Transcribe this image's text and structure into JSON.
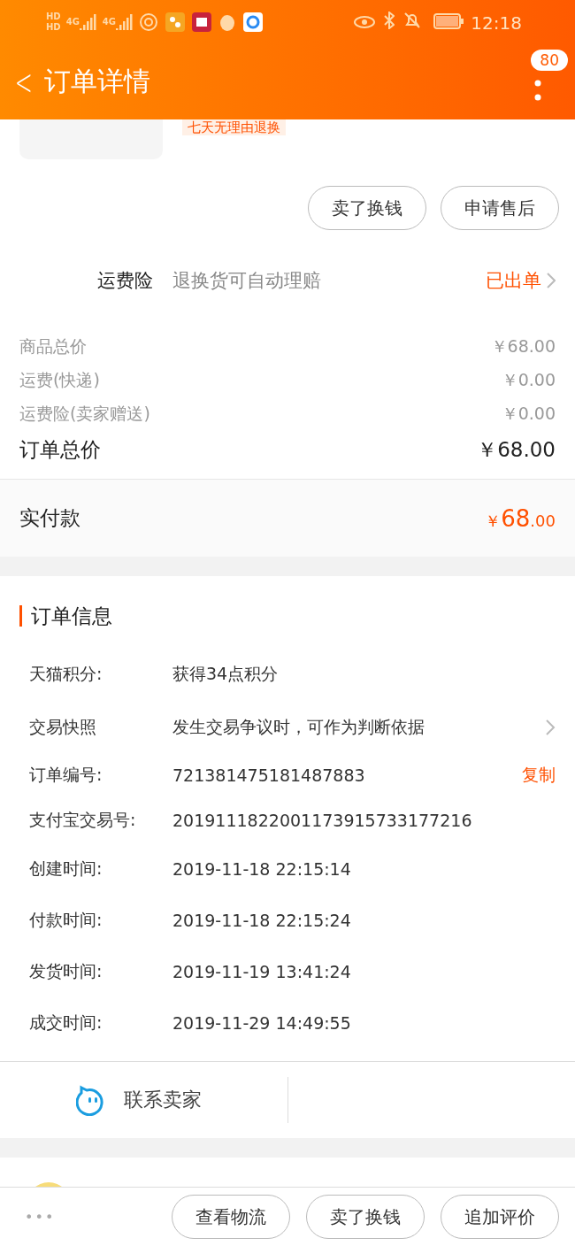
{
  "status_bar": {
    "hd_labels": [
      "HD",
      "HD"
    ],
    "network_labels": [
      "4G",
      "4G"
    ],
    "time": "12:18"
  },
  "header": {
    "back": "<",
    "title": "订单详情",
    "badge": "80"
  },
  "product": {
    "tag": "七天无理由退换"
  },
  "item_actions": [
    "卖了换钱",
    "申请售后"
  ],
  "insurance": {
    "label": "运费险",
    "description": "退换货可自动理赔",
    "status": "已出单"
  },
  "prices": [
    {
      "label": "商品总价",
      "value": "￥68.00"
    },
    {
      "label": "运费(快递)",
      "value": "￥0.00"
    },
    {
      "label": "运费险(卖家赠送)",
      "value": "￥0.00"
    }
  ],
  "total": {
    "label": "订单总价",
    "value": "￥68.00"
  },
  "paid": {
    "label": "实付款",
    "currency": "￥",
    "integer": "68",
    "decimal": ".00"
  },
  "order_info": {
    "title": "订单信息",
    "rows": [
      {
        "label": "天猫积分:",
        "value": "获得34点积分",
        "kind": "plain"
      },
      {
        "label": "交易快照",
        "value": "发生交易争议时，可作为判断依据",
        "kind": "link"
      },
      {
        "label": "订单编号:",
        "value": "721381475181487883",
        "kind": "copy",
        "action": "复制"
      },
      {
        "label": "支付宝交易号:",
        "value": "2019111822001173915733177216",
        "kind": "plain"
      },
      {
        "label": "创建时间:",
        "value": "2019-11-18 22:15:14",
        "kind": "plain"
      },
      {
        "label": "付款时间:",
        "value": "2019-11-18 22:15:24",
        "kind": "plain"
      },
      {
        "label": "发货时间:",
        "value": "2019-11-19 13:41:24",
        "kind": "plain"
      },
      {
        "label": "成交时间:",
        "value": "2019-11-29 14:49:55",
        "kind": "plain"
      }
    ]
  },
  "contact": {
    "label": "联系卖家"
  },
  "bottom_bar": {
    "more": "•••",
    "buttons": [
      "查看物流",
      "卖了换钱",
      "追加评价"
    ]
  }
}
